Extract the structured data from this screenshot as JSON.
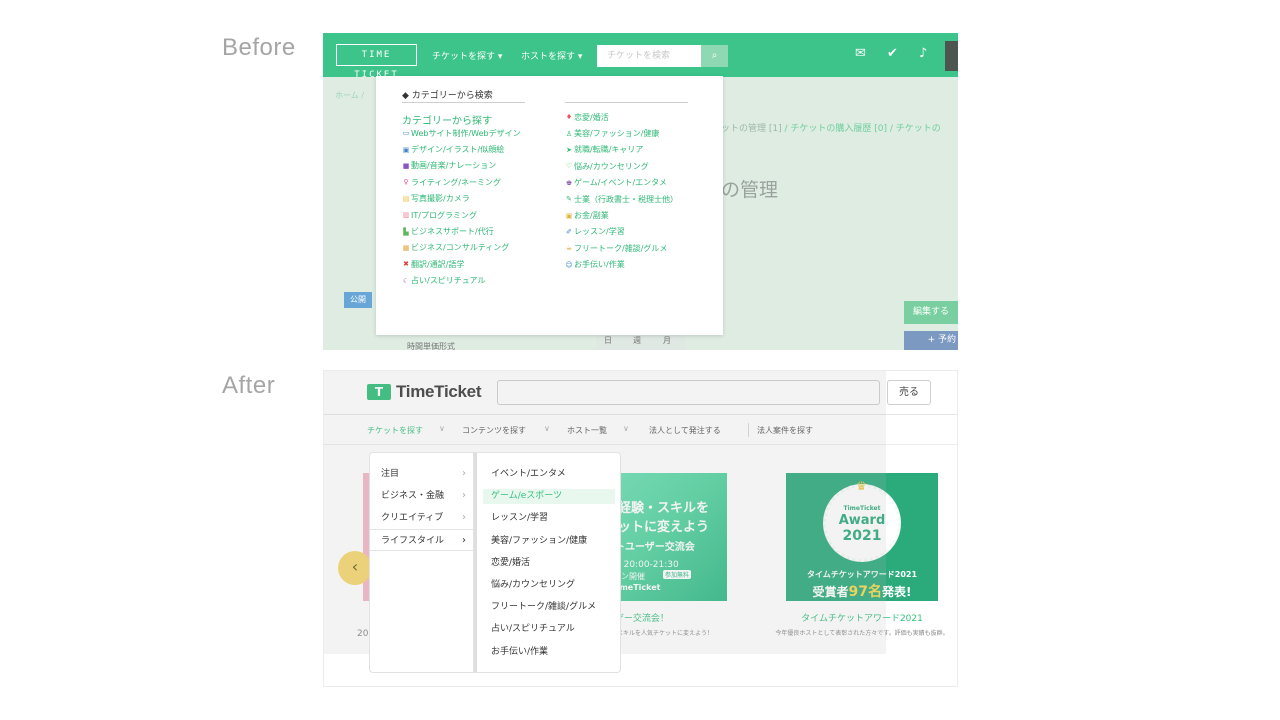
{
  "labels": {
    "before": "Before",
    "after": "After"
  },
  "before": {
    "logo": "TIME TICKET",
    "nav": [
      "チケットを探す ▾",
      "ホストを探す ▾"
    ],
    "search_placeholder": "チケットを検索",
    "breadcrumb": "ホーム /",
    "tabs_crumb_1": "ットの管理 [1]",
    "tabs_crumb_2": "/ チケットの購入履歴 [0] / チケットの",
    "heading": "の管理",
    "public_badge": "公開",
    "edit_button": "編集する",
    "reserve_button": "+ 予約",
    "days": [
      "日",
      "週",
      "月"
    ],
    "format_label": "時間単価形式",
    "dropdown": {
      "header": "カテゴリーから検索",
      "category_title": "カテゴリーから探す",
      "left_items": [
        {
          "icon": "▭",
          "color": "#3a86c9",
          "label": "Webサイト制作/Webデザイン"
        },
        {
          "icon": "▣",
          "color": "#3a86c9",
          "label": "デザイン/イラスト/似顔絵"
        },
        {
          "icon": "■",
          "color": "#8b54c4",
          "label": "動画/音楽/ナレーション"
        },
        {
          "icon": "♀",
          "color": "#e85a9b",
          "label": "ライティング/ネーミング"
        },
        {
          "icon": "▤",
          "color": "#e8c13a",
          "label": "写真撮影/カメラ"
        },
        {
          "icon": "▥",
          "color": "#e8838f",
          "label": "IT/プログラミング"
        },
        {
          "icon": "▙",
          "color": "#5fb85f",
          "label": "ビジネスサポート/代行"
        },
        {
          "icon": "▦",
          "color": "#e0a33a",
          "label": "ビジネス/コンサルティング"
        },
        {
          "icon": "✖",
          "color": "#e03a3a",
          "label": "翻訳/通訳/語学"
        },
        {
          "icon": "☾",
          "color": "#b05aa8",
          "label": "占い/スピリチュアル"
        }
      ],
      "right_items": [
        {
          "icon": "♦",
          "color": "#e8575a",
          "label": "恋愛/婚活"
        },
        {
          "icon": "♙",
          "color": "#2db874",
          "label": "美容/ファッション/健康"
        },
        {
          "icon": "➤",
          "color": "#2db874",
          "label": "就職/転職/キャリア"
        },
        {
          "icon": "♡",
          "color": "#6cbf3a",
          "label": "悩み/カウンセリング"
        },
        {
          "icon": "♚",
          "color": "#7b4fa8",
          "label": "ゲーム/イベント/エンタメ"
        },
        {
          "icon": "✎",
          "color": "#2db874",
          "label": "士業（行政書士・税理士他）"
        },
        {
          "icon": "▣",
          "color": "#e0b43a",
          "label": "お金/副業"
        },
        {
          "icon": "✐",
          "color": "#3a86c9",
          "label": "レッスン/学習"
        },
        {
          "icon": "☕",
          "color": "#e0a33a",
          "label": "フリートーク/雑談/グルメ"
        },
        {
          "icon": "☺",
          "color": "#3a86c9",
          "label": "お手伝い/作業"
        }
      ]
    }
  },
  "after": {
    "logo_mark": "T",
    "logo_text": "TimeTicket",
    "sell_button": "売る",
    "nav": [
      "チケットを探す",
      "コンテンツを探す",
      "ホスト一覧",
      "法人として発注する",
      "法人案件を探す"
    ],
    "categories": [
      "注目",
      "ビジネス・金融",
      "クリエイティブ",
      "ライフスタイル"
    ],
    "subcategories": [
      "イベント/エンタメ",
      "ゲーム/eスポーツ",
      "レッスン/学習",
      "美容/ファッション/健康",
      "恋愛/婚活",
      "悩み/カウンセリング",
      "フリートーク/雑談/グルメ",
      "占い/スピリチュアル",
      "お手伝い/作業"
    ],
    "highlighted_subcategory": "ゲーム/eスポーツ",
    "carousel_prev": "‹",
    "year_fragment": "20",
    "banner2": {
      "line1": "の経験・スキルを",
      "line2": "ケットに変えよう",
      "line3": "ケットユーザー交流会",
      "date": "6(木) 20:00-21:30",
      "online": "ンライン開催",
      "free": "参加無料",
      "logo": "T TimeTicket",
      "title": "ユーザー交流会！",
      "desc": "験・スキルを人気チケットに変えよう！"
    },
    "banner3": {
      "small": "TimeTicket",
      "award": "Award",
      "year": "2021",
      "line1": "タイムチケットアワード2021",
      "line2_pre": "受賞者",
      "line2_num": "97名",
      "line2_post": "発表!",
      "title": "タイムチケットアワード2021",
      "desc": "今年優良ホストとして表彰された方々です。評価も実績も抜群。"
    }
  }
}
